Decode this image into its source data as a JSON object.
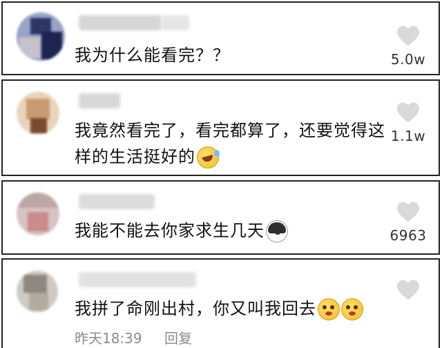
{
  "comments": [
    {
      "text": "我为什么能看完？？",
      "likes": "5.0w",
      "emoji": ""
    },
    {
      "text": "我竟然看完了，看完都算了，还要觉得这样的生活挺好的",
      "likes": "1.1w",
      "emoji": "laughing-crying-emoji"
    },
    {
      "text": "我能不能去你家求生几天",
      "likes": "6963",
      "emoji": "dog-emoji"
    },
    {
      "text": "我拼了命刚出村，你又叫我回去",
      "likes": "",
      "emoji": "crying-face-emoji",
      "time": "昨天18:39",
      "reply_label": "回复"
    }
  ],
  "colors": {
    "text": "#111111",
    "meta": "#8a8a8a",
    "heart": "#d9d9d9",
    "border": "#222222"
  }
}
